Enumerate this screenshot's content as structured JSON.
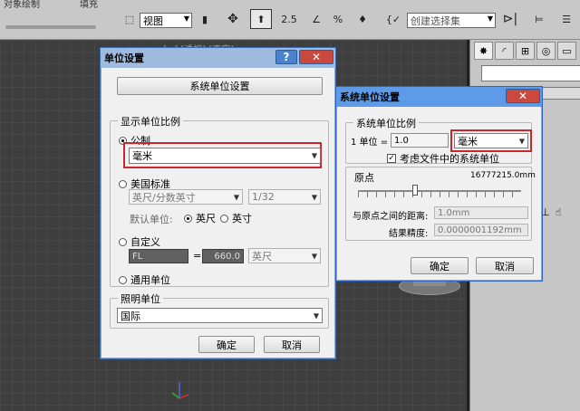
{
  "toolbar": {
    "top_left_label": "对象绘制",
    "top_mid_label": "填充",
    "view_combo": "视图",
    "snap_25": "2.5",
    "percent": "%",
    "selection_set": "创建选择集"
  },
  "viewport": {
    "overlay_label": "[+] [透视] [真实]"
  },
  "units_dialog": {
    "title": "单位设置",
    "help": "?",
    "close": "✕",
    "system_units_button": "系统单位设置",
    "display_scale_label": "显示单位比例",
    "metric_label": "公制",
    "metric_value": "毫米",
    "us_standard_label": "美国标准",
    "us_unit_value": "英尺/分数英寸",
    "us_fraction_value": "1/32",
    "default_unit_label": "默认单位:",
    "feet_label": "英尺",
    "inch_label": "英寸",
    "custom_label": "自定义",
    "custom_name_value": "FL",
    "equals": "=",
    "custom_amount_value": "660.0",
    "custom_unit_value": "英尺",
    "generic_label": "通用单位",
    "lighting_label": "照明单位",
    "lighting_value": "国际",
    "ok": "确定",
    "cancel": "取消"
  },
  "system_dialog": {
    "title": "系统单位设置",
    "close": "✕",
    "scale_group_label": "系统单位比例",
    "one_unit_label": "1 单位 =",
    "scale_value": "1.0",
    "unit_value": "毫米",
    "respect_file_label": "考虑文件中的系统单位",
    "respect_checked": true,
    "origin_label": "原点",
    "origin_value": "16777215.0mm",
    "distance_label": "与原点之间的距离:",
    "distance_value": "1.0mm",
    "precision_label": "结果精度:",
    "precision_value": "0.0000001192mm",
    "ok": "确定",
    "cancel": "取消"
  },
  "colors": {
    "highlight_red": "#c8282a",
    "title_active": "#5d9ae8",
    "title_inactive": "#9fbbe0"
  }
}
